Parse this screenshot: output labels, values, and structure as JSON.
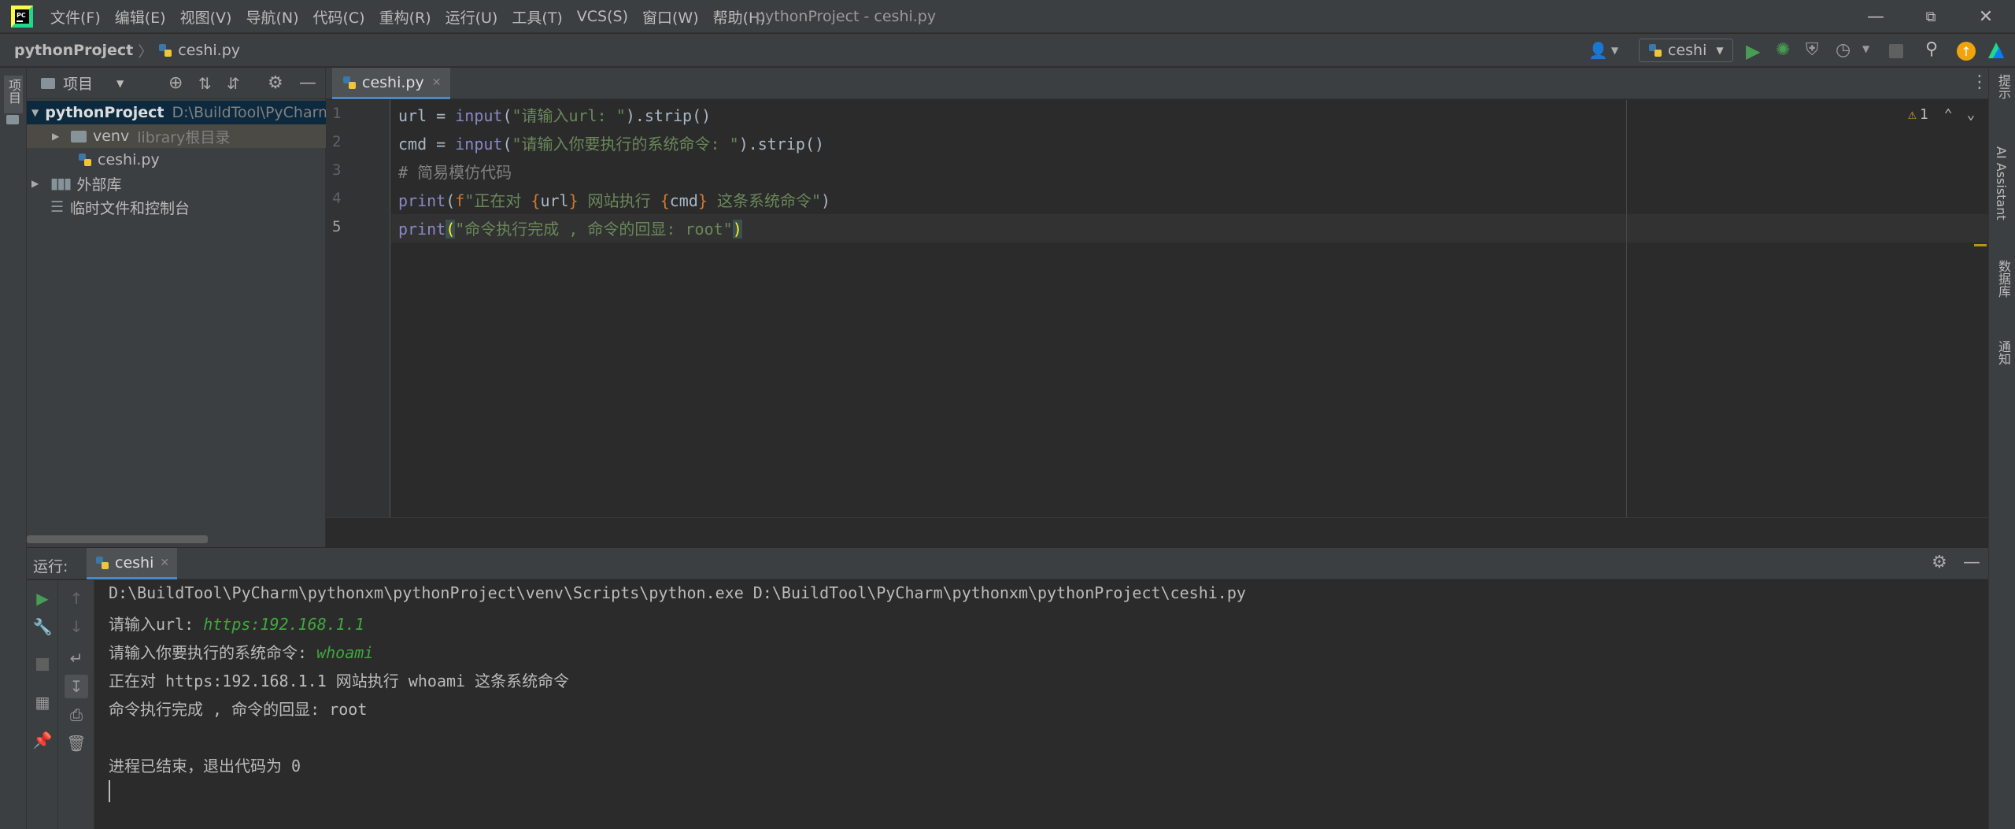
{
  "window": {
    "title": "pythonProject - ceshi.py",
    "menu": [
      "文件(F)",
      "编辑(E)",
      "视图(V)",
      "导航(N)",
      "代码(C)",
      "重构(R)",
      "运行(U)",
      "工具(T)",
      "VCS(S)",
      "窗口(W)",
      "帮助(H)"
    ]
  },
  "breadcrumb": {
    "project": "pythonProject",
    "file": "ceshi.py"
  },
  "toolbar": {
    "run_config": "ceshi"
  },
  "left_stripe": {
    "project_label": "项目"
  },
  "right_stripe": {
    "labels": [
      "提示",
      "AI Assistant",
      "数据库",
      "通知"
    ]
  },
  "project_panel": {
    "header": "项目",
    "tree": [
      {
        "label": "pythonProject",
        "hint": "D:\\BuildTool\\PyCharm"
      },
      {
        "label": "venv",
        "hint": "library根目录"
      },
      {
        "label": "ceshi.py",
        "hint": ""
      },
      {
        "label": "外部库",
        "hint": ""
      },
      {
        "label": "临时文件和控制台",
        "hint": ""
      }
    ]
  },
  "editor": {
    "tab": "ceshi.py",
    "warnings": "1",
    "lines": [
      {
        "n": "1",
        "code": "url = input(\"请输入url: \").strip()"
      },
      {
        "n": "2",
        "code": "cmd = input(\"请输入你要执行的系统命令: \").strip()"
      },
      {
        "n": "3",
        "code": "# 简易模仿代码"
      },
      {
        "n": "4",
        "code": "print(f\"正在对 {url} 网站执行 {cmd} 这条系统命令\")"
      },
      {
        "n": "5",
        "code": "print(\"命令执行完成 , 命令的回显: root\")"
      }
    ]
  },
  "run_panel": {
    "label": "运行:",
    "tab": "ceshi",
    "console": {
      "cmd": "D:\\BuildTool\\PyCharm\\pythonxm\\pythonProject\\venv\\Scripts\\python.exe D:\\BuildTool\\PyCharm\\pythonxm\\pythonProject\\ceshi.py",
      "prompt1": "请输入url: ",
      "input1": "https:192.168.1.1",
      "prompt2": "请输入你要执行的系统命令: ",
      "input2": "whoami",
      "out1": "正在对 https:192.168.1.1 网站执行 whoami 这条系统命令",
      "out2": "命令执行完成 , 命令的回显: root",
      "exit": "进程已结束，退出代码为 0"
    }
  },
  "colors": {
    "accent": "#4a88c7",
    "run_green": "#499c54",
    "string_green": "#6a8759"
  }
}
